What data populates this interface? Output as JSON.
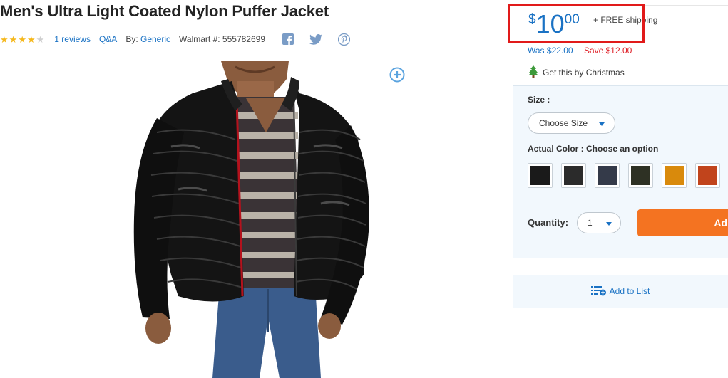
{
  "product": {
    "title": "Men's Ultra Light Coated Nylon Puffer Jacket",
    "rating": 4,
    "rating_max": 5,
    "reviews_label": "1 reviews",
    "qa_label": "Q&A",
    "by_prefix": "By:",
    "brand": "Generic",
    "walmart_number": "Walmart #: 555782699"
  },
  "social": {
    "icons": [
      "facebook-icon",
      "twitter-icon",
      "pinterest-icon"
    ]
  },
  "price": {
    "currency": "$",
    "dollars": "10",
    "cents": "00",
    "shipping": "+ FREE shipping",
    "was": "Was $22.00",
    "save": "Save $12.00",
    "delivery_note": "Get this by Christmas"
  },
  "options": {
    "size_label": "Size :",
    "size_placeholder": "Choose Size",
    "color_label": "Actual Color : Choose an option",
    "swatches": [
      {
        "name": "black-coated",
        "color": "#1a1a1a"
      },
      {
        "name": "charcoal",
        "color": "#2b2b2b"
      },
      {
        "name": "navy",
        "color": "#343a49"
      },
      {
        "name": "olive",
        "color": "#2e3124"
      },
      {
        "name": "mustard",
        "color": "#d98a0c"
      },
      {
        "name": "rust",
        "color": "#c1441c"
      }
    ],
    "quantity_label": "Quantity:",
    "quantity_value": "1",
    "add_to_cart_label": "Ad"
  },
  "add_to_list_label": "Add to List",
  "colors": {
    "link_blue": "#1a72c4",
    "save_red": "#de1c24",
    "highlight_red": "#e11a1a",
    "cart_orange": "#f47321",
    "star_gold": "#f5b81c",
    "panel_bg": "#f2f8fd"
  }
}
